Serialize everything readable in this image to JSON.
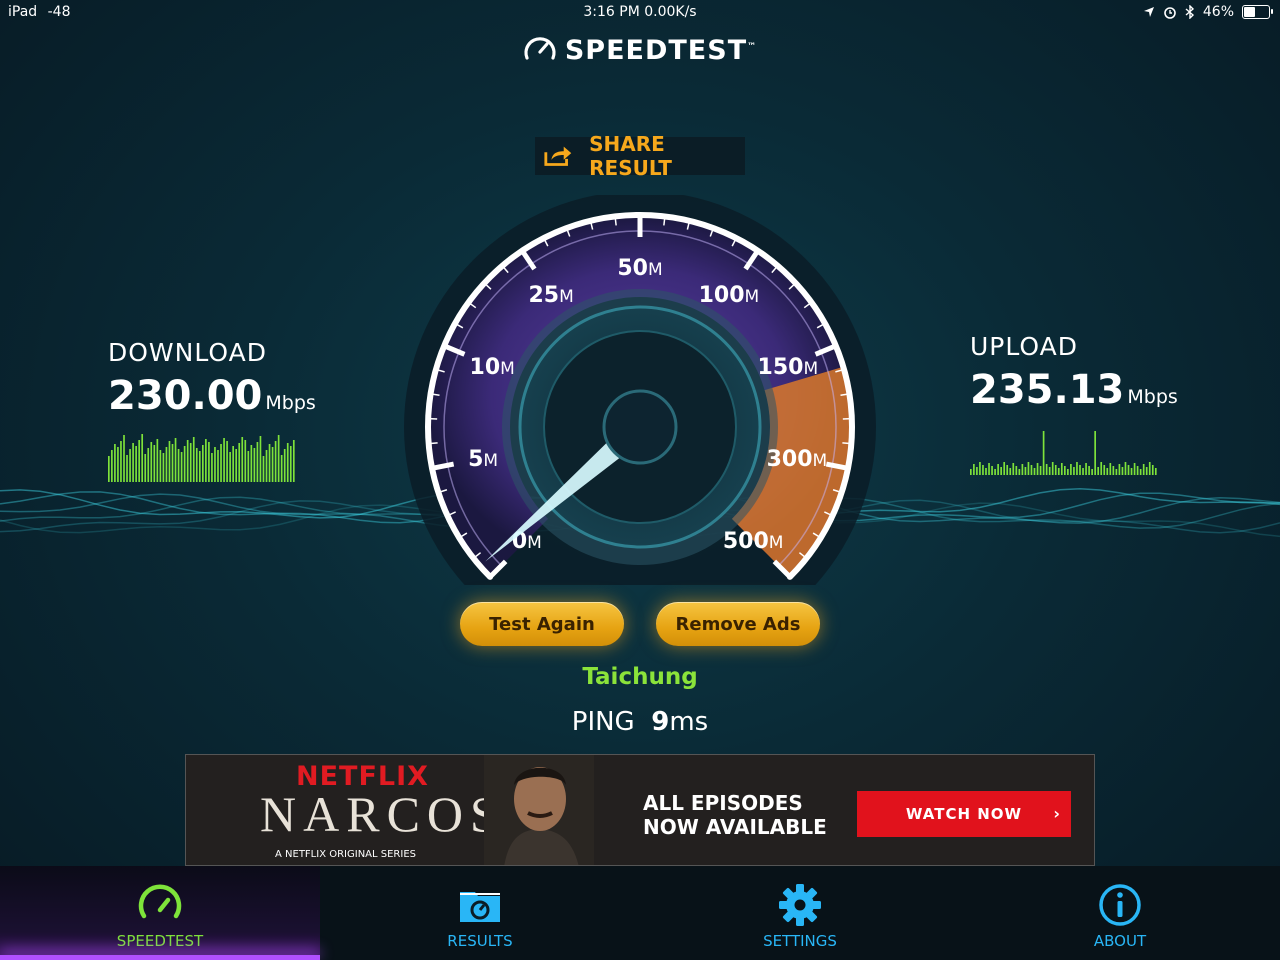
{
  "status_bar": {
    "carrier": "iPad",
    "signal": "-48",
    "time_speed": "3:16 PM 0.00K/s",
    "battery": "46%",
    "icons": [
      "location-arrow-icon",
      "alarm-icon",
      "bluetooth-icon",
      "battery-icon"
    ]
  },
  "app": {
    "title": "SPEEDTEST",
    "tm": "™"
  },
  "share": {
    "label": "SHARE RESULT",
    "icon": "share-icon"
  },
  "download": {
    "label": "DOWNLOAD",
    "value": "230.00",
    "unit": "Mbps"
  },
  "upload": {
    "label": "UPLOAD",
    "value": "235.13",
    "unit": "Mbps"
  },
  "gauge": {
    "ticks": [
      {
        "num": "0",
        "unit": "M"
      },
      {
        "num": "5",
        "unit": "M"
      },
      {
        "num": "10",
        "unit": "M"
      },
      {
        "num": "25",
        "unit": "M"
      },
      {
        "num": "50",
        "unit": "M"
      },
      {
        "num": "100",
        "unit": "M"
      },
      {
        "num": "150",
        "unit": "M"
      },
      {
        "num": "300",
        "unit": "M"
      },
      {
        "num": "500",
        "unit": "M"
      }
    ],
    "needle_value_m": 0,
    "colors": {
      "low": "#6a3fb5",
      "high": "#d9782a",
      "ring": "#ffffff"
    }
  },
  "buttons": {
    "test_again": "Test Again",
    "remove_ads": "Remove Ads"
  },
  "server": {
    "name": "Taichung"
  },
  "ping": {
    "label": "PING",
    "value": "9",
    "unit": "ms"
  },
  "ad": {
    "brand": "NETFLIX",
    "show": "NARCOS",
    "subtitle": "A NETFLIX ORIGINAL SERIES",
    "headline_1": "ALL EPISODES",
    "headline_2": "NOW AVAILABLE",
    "cta": "WATCH NOW",
    "cta_chevron": "›"
  },
  "tabs": [
    {
      "label": "SPEEDTEST",
      "icon": "speedometer-icon",
      "active": true,
      "color": "#7ee33a"
    },
    {
      "label": "RESULTS",
      "icon": "results-folder-icon",
      "active": false,
      "color": "#29b6f6"
    },
    {
      "label": "SETTINGS",
      "icon": "gear-icon",
      "active": false,
      "color": "#29b6f6"
    },
    {
      "label": "ABOUT",
      "icon": "info-icon",
      "active": false,
      "color": "#29b6f6"
    }
  ]
}
